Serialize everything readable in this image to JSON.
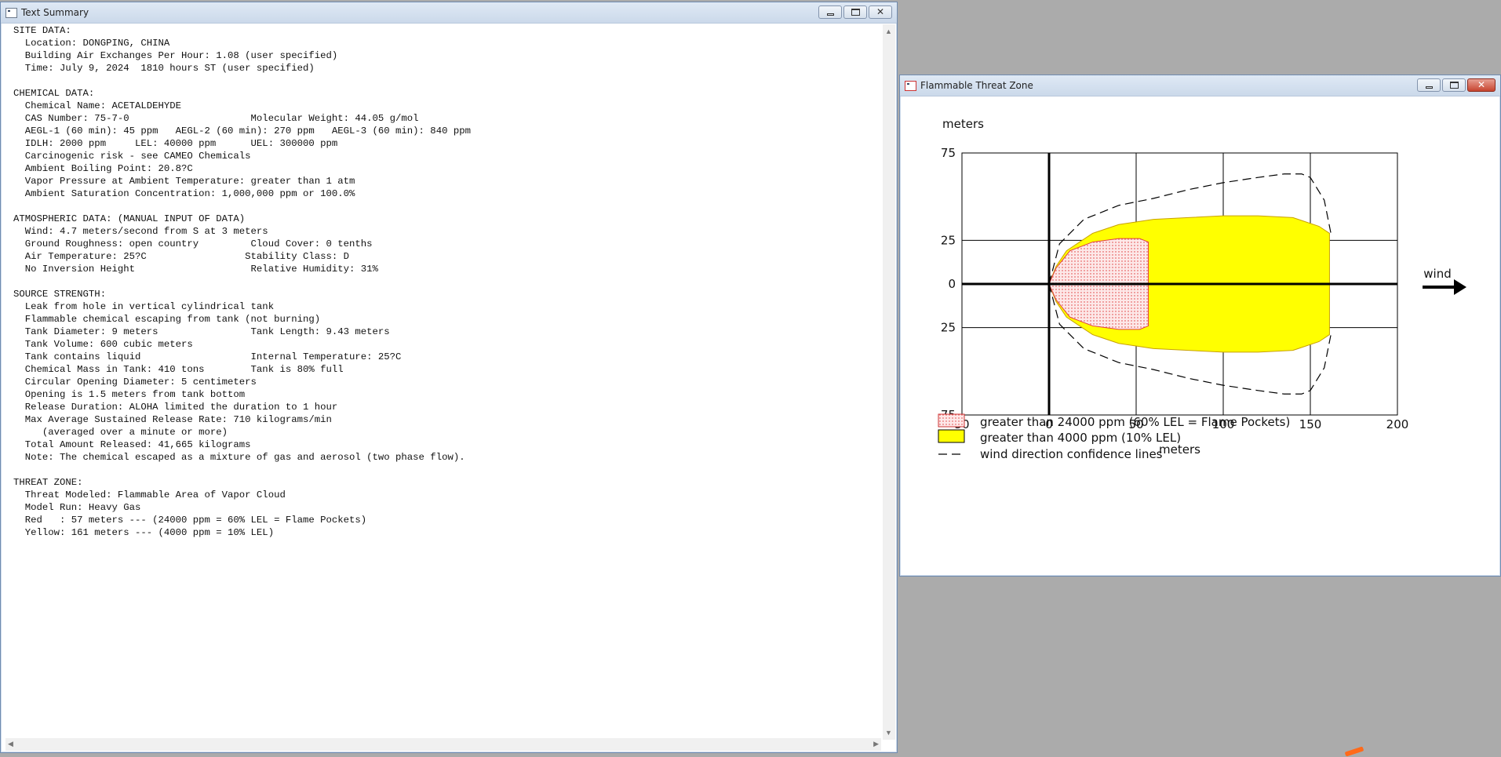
{
  "text_window": {
    "title": "Text Summary",
    "lines": [
      "SITE DATA:",
      "  Location: DONGPING, CHINA",
      "  Building Air Exchanges Per Hour: 1.08 (user specified)",
      "  Time: July 9, 2024  1810 hours ST (user specified)",
      "",
      "CHEMICAL DATA:",
      "  Chemical Name: ACETALDEHYDE",
      "  CAS Number: 75-7-0                     Molecular Weight: 44.05 g/mol",
      "  AEGL-1 (60 min): 45 ppm   AEGL-2 (60 min): 270 ppm   AEGL-3 (60 min): 840 ppm",
      "  IDLH: 2000 ppm     LEL: 40000 ppm      UEL: 300000 ppm",
      "  Carcinogenic risk - see CAMEO Chemicals",
      "  Ambient Boiling Point: 20.8?C",
      "  Vapor Pressure at Ambient Temperature: greater than 1 atm",
      "  Ambient Saturation Concentration: 1,000,000 ppm or 100.0%",
      "",
      "ATMOSPHERIC DATA: (MANUAL INPUT OF DATA)",
      "  Wind: 4.7 meters/second from S at 3 meters",
      "  Ground Roughness: open country         Cloud Cover: 0 tenths",
      "  Air Temperature: 25?C                 Stability Class: D",
      "  No Inversion Height                    Relative Humidity: 31%",
      "",
      "SOURCE STRENGTH:",
      "  Leak from hole in vertical cylindrical tank",
      "  Flammable chemical escaping from tank (not burning)",
      "  Tank Diameter: 9 meters                Tank Length: 9.43 meters",
      "  Tank Volume: 600 cubic meters",
      "  Tank contains liquid                   Internal Temperature: 25?C",
      "  Chemical Mass in Tank: 410 tons        Tank is 80% full",
      "  Circular Opening Diameter: 5 centimeters",
      "  Opening is 1.5 meters from tank bottom",
      "  Release Duration: ALOHA limited the duration to 1 hour",
      "  Max Average Sustained Release Rate: 710 kilograms/min",
      "     (averaged over a minute or more)",
      "  Total Amount Released: 41,665 kilograms",
      "  Note: The chemical escaped as a mixture of gas and aerosol (two phase flow).",
      "",
      "THREAT ZONE:",
      "  Threat Modeled: Flammable Area of Vapor Cloud",
      "  Model Run: Heavy Gas",
      "  Red   : 57 meters --- (24000 ppm = 60% LEL = Flame Pockets)",
      "  Yellow: 161 meters --- (4000 ppm = 10% LEL)"
    ]
  },
  "chart_window": {
    "title": "Flammable Threat Zone",
    "close_glyph": "✕",
    "colors": {
      "red_zone": "#ff9a9a",
      "yellow_zone": "#ffff00",
      "axis": "#000000"
    },
    "wind_label": "wind",
    "legend": [
      {
        "label": "greater than 24000 ppm (60% LEL = Flame Pockets)"
      },
      {
        "label": "greater than 4000 ppm (10% LEL)"
      },
      {
        "label": "wind direction confidence lines"
      }
    ]
  },
  "chart_data": {
    "type": "area",
    "xlabel": "meters",
    "ylabel": "meters",
    "xlim": [
      -50,
      200
    ],
    "ylim": [
      -75,
      75
    ],
    "x_ticks": [
      "50",
      "0",
      "50",
      "100",
      "150",
      "200"
    ],
    "x_tick_values": [
      -50,
      0,
      50,
      100,
      150,
      200
    ],
    "y_ticks": [
      "75",
      "25",
      "0",
      "25",
      "75"
    ],
    "y_tick_values": [
      75,
      25,
      0,
      -25,
      -75
    ],
    "grid": true,
    "legend_position": "bottom-left",
    "series": [
      {
        "name": "greater than 4000 ppm (10% LEL)",
        "color": "#ffff00",
        "x": [
          0,
          4,
          10,
          25,
          40,
          60,
          80,
          100,
          120,
          140,
          155,
          161,
          161,
          155,
          140,
          120,
          100,
          80,
          60,
          40,
          25,
          10,
          4,
          0
        ],
        "y": [
          0,
          10,
          19,
          29,
          34,
          37,
          38,
          39,
          39,
          38,
          33,
          29,
          -29,
          -33,
          -38,
          -39,
          -39,
          -38,
          -37,
          -34,
          -29,
          -19,
          -10,
          0
        ]
      },
      {
        "name": "greater than 24000 ppm (60% LEL = Flame Pockets)",
        "color": "#ff9a9a",
        "x": [
          0,
          4,
          12,
          25,
          40,
          52,
          57,
          57,
          52,
          40,
          25,
          12,
          4,
          0
        ],
        "y": [
          0,
          9,
          19,
          24,
          26,
          26,
          24,
          -24,
          -26,
          -26,
          -24,
          -19,
          -9,
          0
        ]
      },
      {
        "name": "wind direction confidence lines",
        "color": "#000000",
        "x": [
          0,
          6,
          20,
          40,
          60,
          80,
          100,
          120,
          135,
          145,
          150,
          158,
          162
        ],
        "y": [
          0,
          23,
          37,
          45,
          49,
          54,
          58,
          61,
          63,
          63,
          61,
          48,
          28
        ]
      }
    ]
  }
}
